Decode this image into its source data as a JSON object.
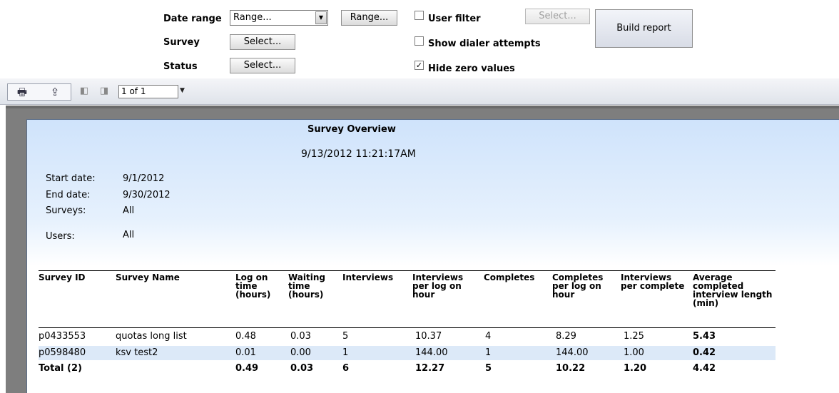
{
  "filters": {
    "date_range_label": "Date range",
    "date_range_value": "Range...",
    "range_button": "Range...",
    "survey_label": "Survey",
    "survey_button": "Select...",
    "status_label": "Status",
    "status_button": "Select...",
    "user_filter_label": "User filter",
    "user_filter_checked": false,
    "user_select_button": "Select...",
    "show_dialer_label": "Show dialer attempts",
    "show_dialer_checked": false,
    "hide_zero_label": "Hide zero values",
    "hide_zero_checked": true,
    "check_mark": "✓",
    "build_button": "Build report"
  },
  "toolbar": {
    "page_indicator": "1 of 1",
    "icons": [
      "print-icon",
      "export-icon",
      "previous-page-icon",
      "next-page-icon",
      "dropdown-arrow-icon"
    ]
  },
  "report": {
    "title": "Survey Overview",
    "timestamp": "9/13/2012  11:21:17AM",
    "meta": {
      "start_label": "Start date:",
      "start_value": "9/1/2012",
      "end_label": "End date:",
      "end_value": "9/30/2012",
      "surveys_label": "Surveys:",
      "surveys_value": "All",
      "users_label": "Users:",
      "users_value": "All"
    },
    "columns": [
      "Survey ID",
      "Survey Name",
      "Log on\ntime\n(hours)",
      "Waiting\ntime\n(hours)",
      "Interviews",
      "Interviews\nper log on\nhour",
      "Completes",
      "Completes\nper log on\nhour",
      "Interviews\nper complete",
      "Average\ncompleted\ninterview length\n(min)"
    ],
    "rows": [
      [
        "p0433553",
        "quotas long list",
        "0.48",
        "0.03",
        "5",
        "10.37",
        "4",
        "8.29",
        "1.25",
        "5.43"
      ],
      [
        "p0598480",
        "ksv test2",
        "0.01",
        "0.00",
        "1",
        "144.00",
        "1",
        "144.00",
        "1.00",
        "0.42"
      ]
    ],
    "total": [
      "Total (2)",
      "",
      "0.49",
      "0.03",
      "6",
      "12.27",
      "5",
      "10.22",
      "1.20",
      "4.42"
    ]
  }
}
